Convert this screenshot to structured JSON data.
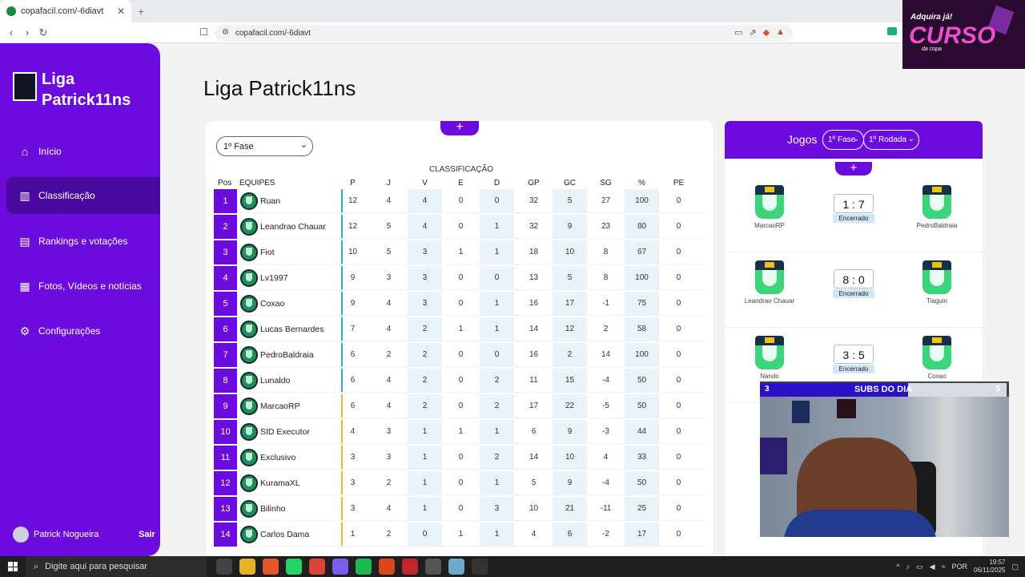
{
  "browser": {
    "tab_title": "copafacil.com/-6diavt",
    "url": "copafacil.com/-6diavt"
  },
  "ad_overlay": {
    "line1": "Adquira já!",
    "line2": "CURSO",
    "line3": "da copa"
  },
  "sidebar": {
    "league_name": "Liga Patrick11ns",
    "items": [
      {
        "label": "Início",
        "icon": "home-icon"
      },
      {
        "label": "Classificação",
        "icon": "podium-icon"
      },
      {
        "label": "Rankings e votações",
        "icon": "ranking-icon"
      },
      {
        "label": "Fotos, Vídeos e notícias",
        "icon": "news-icon"
      },
      {
        "label": "Configurações",
        "icon": "gear-icon"
      }
    ],
    "user_name": "Patrick Nogueira",
    "logout_label": "Sair"
  },
  "page_title": "Liga Patrick11ns",
  "table": {
    "phase_select": "1º Fase",
    "section_label": "CLASSIFICAÇÃO",
    "headers": {
      "pos": "Pos",
      "team": "EQUIPES",
      "cols": [
        "P",
        "J",
        "V",
        "E",
        "D",
        "GP",
        "GC",
        "SG",
        "%",
        "PE"
      ]
    },
    "rows": [
      {
        "pos": "1",
        "team": "Ruan",
        "vals": [
          "12",
          "4",
          "4",
          "0",
          "0",
          "32",
          "5",
          "27",
          "100",
          "0"
        ],
        "zone": "blue"
      },
      {
        "pos": "2",
        "team": "Leandrao Chauar",
        "vals": [
          "12",
          "5",
          "4",
          "0",
          "1",
          "32",
          "9",
          "23",
          "80",
          "0"
        ],
        "zone": "blue"
      },
      {
        "pos": "3",
        "team": "Fiot",
        "vals": [
          "10",
          "5",
          "3",
          "1",
          "1",
          "18",
          "10",
          "8",
          "67",
          "0"
        ],
        "zone": "blue"
      },
      {
        "pos": "4",
        "team": "Lv1997",
        "vals": [
          "9",
          "3",
          "3",
          "0",
          "0",
          "13",
          "5",
          "8",
          "100",
          "0"
        ],
        "zone": "blue"
      },
      {
        "pos": "5",
        "team": "Coxao",
        "vals": [
          "9",
          "4",
          "3",
          "0",
          "1",
          "16",
          "17",
          "-1",
          "75",
          "0"
        ],
        "zone": "blue"
      },
      {
        "pos": "6",
        "team": "Lucas Bernardes",
        "vals": [
          "7",
          "4",
          "2",
          "1",
          "1",
          "14",
          "12",
          "2",
          "58",
          "0"
        ],
        "zone": "blue"
      },
      {
        "pos": "7",
        "team": "PedroBaldraia",
        "vals": [
          "6",
          "2",
          "2",
          "0",
          "0",
          "16",
          "2",
          "14",
          "100",
          "0"
        ],
        "zone": "blue"
      },
      {
        "pos": "8",
        "team": "Lunaldo",
        "vals": [
          "6",
          "4",
          "2",
          "0",
          "2",
          "11",
          "15",
          "-4",
          "50",
          "0"
        ],
        "zone": "blue"
      },
      {
        "pos": "9",
        "team": "MarcaoRP",
        "vals": [
          "6",
          "4",
          "2",
          "0",
          "2",
          "17",
          "22",
          "-5",
          "50",
          "0"
        ],
        "zone": "yellow"
      },
      {
        "pos": "10",
        "team": "SID Executor",
        "vals": [
          "4",
          "3",
          "1",
          "1",
          "1",
          "6",
          "9",
          "-3",
          "44",
          "0"
        ],
        "zone": "yellow"
      },
      {
        "pos": "11",
        "team": "Exclusivo",
        "vals": [
          "3",
          "3",
          "1",
          "0",
          "2",
          "14",
          "10",
          "4",
          "33",
          "0"
        ],
        "zone": "yellow"
      },
      {
        "pos": "12",
        "team": "KuramaXL",
        "vals": [
          "3",
          "2",
          "1",
          "0",
          "1",
          "5",
          "9",
          "-4",
          "50",
          "0"
        ],
        "zone": "yellow"
      },
      {
        "pos": "13",
        "team": "Bilinho",
        "vals": [
          "3",
          "4",
          "1",
          "0",
          "3",
          "10",
          "21",
          "-11",
          "25",
          "0"
        ],
        "zone": "yellow"
      },
      {
        "pos": "14",
        "team": "Carlos Dama",
        "vals": [
          "1",
          "2",
          "0",
          "1",
          "1",
          "4",
          "6",
          "-2",
          "17",
          "0"
        ],
        "zone": "yellow"
      }
    ]
  },
  "games": {
    "title": "Jogos",
    "phase_select": "1º Fase",
    "round_select": "1º Rodada",
    "matches": [
      {
        "home": "MarcaoRP",
        "away": "PedroBaldraia",
        "score": "1 : 7",
        "status": "Encerrado"
      },
      {
        "home": "Leandrao Chauar",
        "away": "Tiaguin",
        "score": "8 : 0",
        "status": "Encerrado"
      },
      {
        "home": "Nando",
        "away": "Coxao",
        "score": "3 : 5",
        "status": "Encerrado"
      }
    ]
  },
  "webcam": {
    "subs_left": "3",
    "subs_title": "SUBS DO DIA",
    "subs_right": "5",
    "subs_progress": 0.6
  },
  "taskbar": {
    "search_placeholder": "Digite aqui para pesquisar",
    "lang": "POR",
    "time": "19:57",
    "date": "06/11/2025"
  },
  "colors": {
    "brand_purple": "#6c0bde",
    "active_purple": "#4a0aa0",
    "zone_blue": "#38a4d8",
    "zone_yellow": "#efb33e"
  }
}
